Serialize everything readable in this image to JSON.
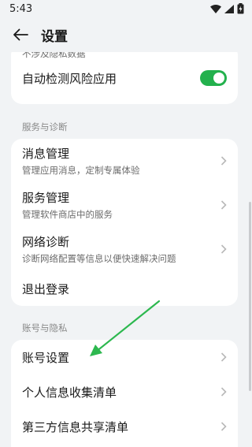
{
  "status_bar": {
    "time": "5:43"
  },
  "header": {
    "title": "设置"
  },
  "top_card": {
    "clipped_text": "不涉及隐私数据",
    "auto_detect_label": "自动检测风险应用",
    "auto_detect_enabled": true
  },
  "section_services": {
    "label": "服务与诊断",
    "items": [
      {
        "title": "消息管理",
        "subtitle": "管理应用消息，定制专属体验"
      },
      {
        "title": "服务管理",
        "subtitle": "管理软件商店中的服务"
      },
      {
        "title": "网络诊断",
        "subtitle": "诊断网络配置等信息以便快速解决问题"
      }
    ],
    "logout_label": "退出登录"
  },
  "section_account": {
    "label": "账号与隐私",
    "items": [
      {
        "title": "账号设置"
      },
      {
        "title": "个人信息收集清单"
      },
      {
        "title": "第三方信息共享清单"
      }
    ]
  },
  "colors": {
    "accent": "#23b14d",
    "annotation_arrow": "#2db84f",
    "background": "#f1f3f5"
  }
}
